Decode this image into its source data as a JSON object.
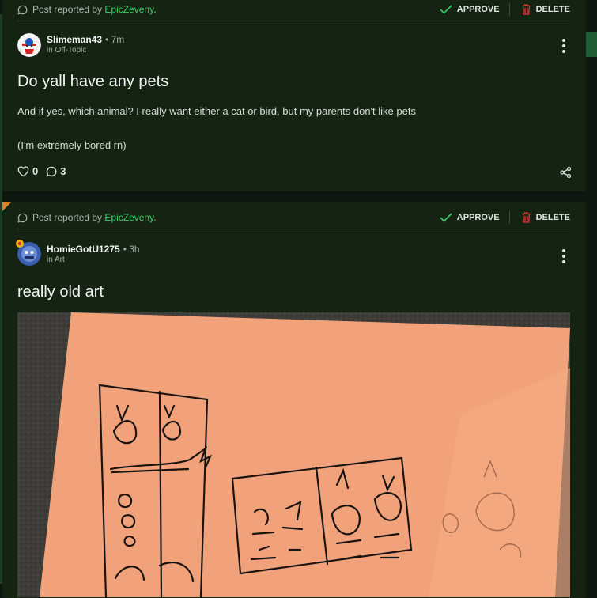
{
  "posts": [
    {
      "report": {
        "text": "Post reported by",
        "reporter": "EpicZeveny",
        "suffix": "."
      },
      "actions": {
        "approve": "APPROVE",
        "delete": "DELETE"
      },
      "author": {
        "name": "Slimeman43",
        "separator": "•",
        "time": "7m",
        "category": "in Off-Topic"
      },
      "title": "Do yall have any pets",
      "body": [
        "And if yes, which animal? I really want either a cat or bird, but my parents don't like pets",
        "(I'm extremely bored rn)"
      ],
      "stats": {
        "likes": "0",
        "comments": "3"
      }
    },
    {
      "report": {
        "text": "Post reported by",
        "reporter": "EpicZeveny",
        "suffix": "."
      },
      "actions": {
        "approve": "APPROVE",
        "delete": "DELETE"
      },
      "author": {
        "name": "HomieGotU1275",
        "separator": "•",
        "time": "3h",
        "category": "in Art"
      },
      "title": "really old art"
    }
  ],
  "colors": {
    "accent_green": "#35d16a",
    "delete_red": "#e5393b",
    "card_bg": "#142312",
    "page_bg": "#0d160f",
    "flag_orange": "#d9802a"
  }
}
